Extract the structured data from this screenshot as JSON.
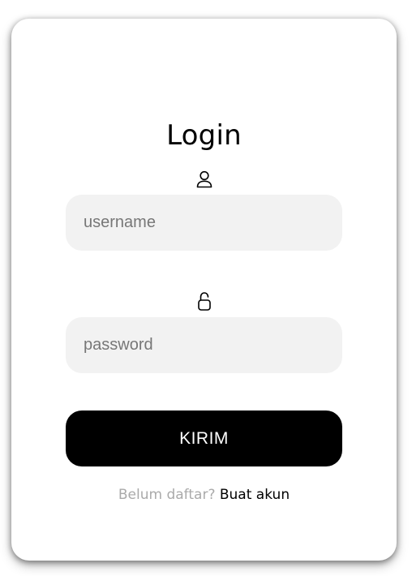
{
  "login_card": {
    "title": "Login",
    "username": {
      "icon": "user-icon",
      "placeholder": "username",
      "value": ""
    },
    "password": {
      "icon": "lock-icon",
      "placeholder": "password",
      "value": ""
    },
    "submit_label": "KIRIM",
    "signup_prompt": "Belum daftar?",
    "signup_link": "Buat akun"
  },
  "colors": {
    "background": "#ffffff",
    "input_background": "#f2f2f2",
    "button_background": "#000000",
    "button_text": "#ffffff",
    "prompt_text": "#aaaaaa"
  }
}
